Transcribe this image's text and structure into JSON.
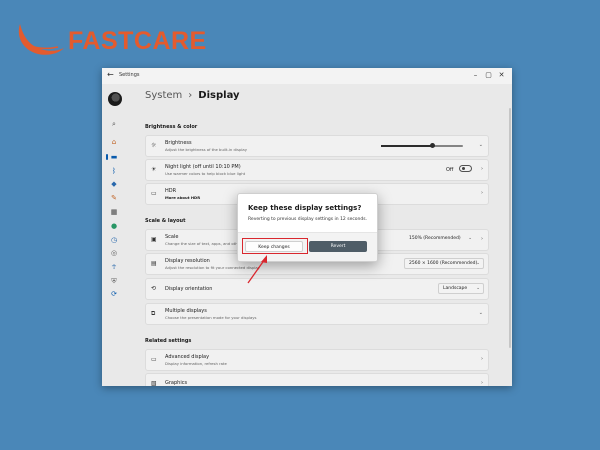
{
  "brand": {
    "name": "FASTCARE",
    "color": "#e35b2e",
    "icon": "fastcare-swoosh-logo"
  },
  "window": {
    "title": "Settings",
    "controls": [
      "minimize",
      "maximize",
      "close"
    ]
  },
  "sidebar": {
    "icons": [
      "home-icon",
      "system-icon",
      "bluetooth-icon",
      "network-icon",
      "personalization-icon",
      "apps-icon",
      "accounts-icon",
      "time-language-icon",
      "gaming-icon",
      "accessibility-icon",
      "privacy-icon",
      "windows-update-icon"
    ],
    "active": "system-icon"
  },
  "header": {
    "parent": "System",
    "separator": "›",
    "current": "Display"
  },
  "sections": {
    "brightness": "Brightness & color",
    "scale": "Scale & layout",
    "related": "Related settings"
  },
  "cards": {
    "brightness": {
      "title": "Brightness",
      "subtitle": "Adjust the brightness of the built-in display",
      "level": 0.62
    },
    "night_light": {
      "title": "Night light (off until 10:10 PM)",
      "subtitle": "Use warmer colors to help block blue light",
      "state": "Off"
    },
    "hdr": {
      "title": "HDR",
      "subtitle": "More about HDR"
    },
    "scale": {
      "title": "Scale",
      "subtitle": "Change the size of text, apps, and other items",
      "value": "150% (Recommended)"
    },
    "resolution": {
      "title": "Display resolution",
      "subtitle": "Adjust the resolution to fit your connected display",
      "value": "2560 × 1600 (Recommended)"
    },
    "orientation": {
      "title": "Display orientation",
      "value": "Landscape"
    },
    "multiple": {
      "title": "Multiple displays",
      "subtitle": "Choose the presentation mode for your displays"
    },
    "advanced": {
      "title": "Advanced display",
      "subtitle": "Display information, refresh rate"
    },
    "graphics": {
      "title": "Graphics"
    }
  },
  "dialog": {
    "title": "Keep these display settings?",
    "message": "Reverting to previous display settings in 12 seconds.",
    "keep": "Keep changes",
    "revert": "Revert"
  },
  "annotation": {
    "color": "#d9272e"
  }
}
